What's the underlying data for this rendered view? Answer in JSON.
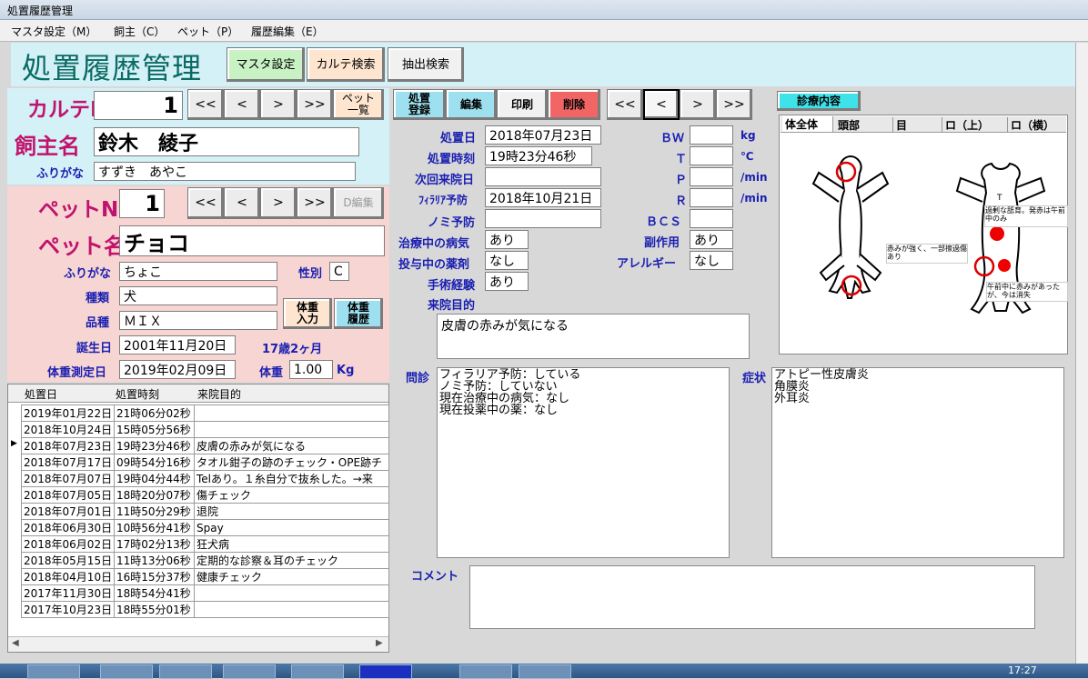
{
  "window": {
    "title": "処置履歴管理"
  },
  "menu": [
    "マスタ設定（M）",
    "飼主（C）",
    "ペット（P）",
    "履歴編集（E）"
  ],
  "header": {
    "title": "処置履歴管理",
    "buttons": [
      "マスタ設定",
      "カルテ検索",
      "抽出検索"
    ]
  },
  "karte": {
    "label_no": "カルテNo",
    "no": "1",
    "nav": [
      "<<",
      "<",
      ">",
      ">>"
    ],
    "list_btn": "ペット\n一覧",
    "label_owner": "飼主名",
    "owner": "鈴木　綾子",
    "label_furigana": "ふりがな",
    "furigana": "すずき　あやこ"
  },
  "pet": {
    "label_no": "ペットNo",
    "no": "1",
    "nav": [
      "<<",
      "<",
      ">",
      ">>"
    ],
    "edit_btn": "D編集",
    "label_name": "ペット名",
    "name": "チョコ",
    "label_furigana": "ふりがな",
    "furigana": "ちょこ",
    "label_sex": "性別",
    "sex": "C",
    "label_species": "種類",
    "species": "犬",
    "label_breed": "品種",
    "breed": "ＭＩＸ",
    "btn_weight_input": "体重\n入力",
    "btn_weight_history": "体重\n履歴",
    "label_birth": "誕生日",
    "birth": "2001年11月20日",
    "age": "17歳2ヶ月",
    "label_weigh_date": "体重測定日",
    "weigh_date": "2019年02月09日",
    "label_weight": "体重",
    "weight": "1.00",
    "weight_unit": "Kg"
  },
  "history": {
    "columns": [
      "処置日",
      "処置時刻",
      "来院目的"
    ],
    "rows": [
      [
        "2019年01月22日",
        "21時06分02秒",
        ""
      ],
      [
        "2018年10月24日",
        "15時05分56秒",
        ""
      ],
      [
        "2018年07月23日",
        "19時23分46秒",
        "皮膚の赤みが気になる"
      ],
      [
        "2018年07月17日",
        "09時54分16秒",
        "タオル鉗子の跡のチェック・OPE跡チ"
      ],
      [
        "2018年07月07日",
        "19時04分44秒",
        "Telあり。１糸自分で抜糸した。→来"
      ],
      [
        "2018年07月05日",
        "18時20分07秒",
        "傷チェック"
      ],
      [
        "2018年07月01日",
        "11時50分29秒",
        "退院"
      ],
      [
        "2018年06月30日",
        "10時56分41秒",
        "Spay"
      ],
      [
        "2018年06月02日",
        "17時02分13秒",
        "狂犬病"
      ],
      [
        "2018年05月15日",
        "11時13分06秒",
        "定期的な診察＆耳のチェック"
      ],
      [
        "2018年04月10日",
        "16時15分37秒",
        "健康チェック"
      ],
      [
        "2017年11月30日",
        "18時54分41秒",
        ""
      ],
      [
        "2017年10月23日",
        "18時55分01秒",
        ""
      ]
    ],
    "selected_marker": "▶"
  },
  "treatment": {
    "buttons": [
      "処置\n登録",
      "編集",
      "印刷",
      "削除"
    ],
    "nav": [
      "<<",
      "<",
      ">",
      ">>"
    ],
    "label_date": "処置日",
    "date": "2018年07月23日",
    "label_time": "処置時刻",
    "time": "19時23分46秒",
    "label_next": "次回来院日",
    "next": "",
    "label_filaria": "ﾌｨﾗﾘｱ予防",
    "filaria": "2018年10月21日",
    "label_flea": "ノミ予防",
    "flea": "",
    "label_disease": "治療中の病気",
    "disease": "あり",
    "label_drug": "投与中の薬剤",
    "drug": "なし",
    "label_surgery": "手術経験",
    "surgery": "あり",
    "label_purpose": "来院目的",
    "purpose": "皮膚の赤みが気になる",
    "label_bw": "ＢＷ",
    "bw_unit": "kg",
    "label_t": "Ｔ",
    "t_unit": "℃",
    "label_p": "Ｐ",
    "p_unit": "/min",
    "label_r": "Ｒ",
    "r_unit": "/min",
    "label_bcs": "ＢＣＳ",
    "label_side": "副作用",
    "side": "あり",
    "label_allergy": "アレルギー",
    "allergy": "なし",
    "label_inquiry": "問診",
    "inquiry": [
      "フィラリア予防：している",
      "ノミ予防：していない",
      "現在治療中の病気：なし",
      "現在投薬中の薬：なし"
    ],
    "label_symptom": "症状",
    "symptom": [
      "アトピー性皮膚炎",
      "角膜炎",
      "外耳炎"
    ],
    "label_comment": "コメント",
    "comment": ""
  },
  "diagnosis": {
    "title": "診療内容",
    "tabs": [
      "体全体",
      "頭部",
      "目",
      "ロ（上）",
      "ロ（横）"
    ],
    "notes": [
      "過剰な舐育。発赤は午前中のみ",
      "赤みが強く、一部擦過傷あり",
      "午前中に赤みがあったが、今は消失"
    ]
  },
  "taskbar": {
    "clock": "17:27"
  }
}
